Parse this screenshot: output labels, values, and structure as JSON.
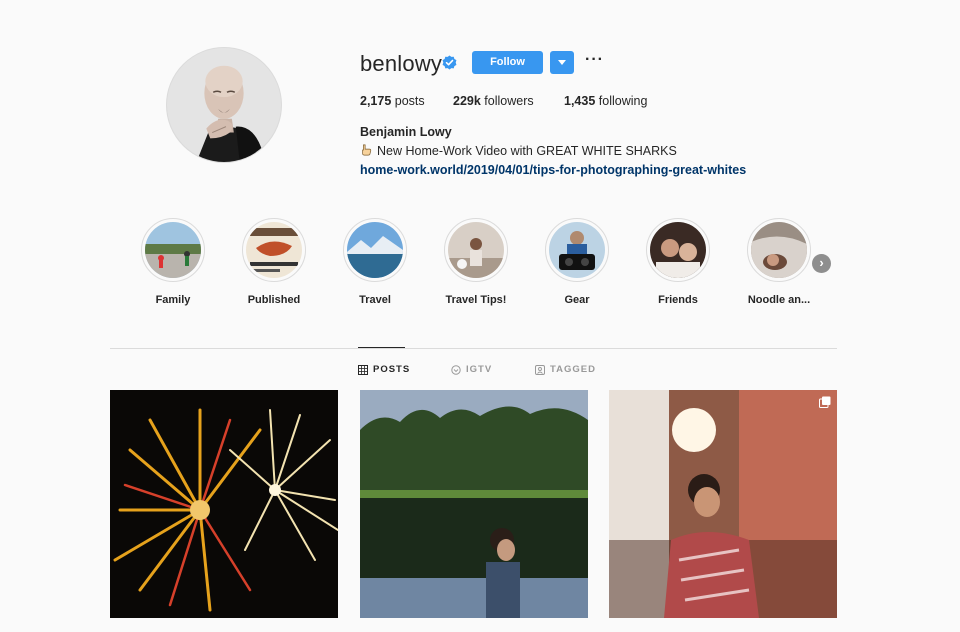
{
  "profile": {
    "username": "benlowy",
    "follow_label": "Follow",
    "more_label": "···",
    "stats": {
      "posts_count": "2,175",
      "posts_label": "posts",
      "followers_count": "229k",
      "followers_label": "followers",
      "following_count": "1,435",
      "following_label": "following"
    },
    "full_name": "Benjamin Lowy",
    "bio": "New Home-Work Video with GREAT WHITE SHARKS",
    "link": "home-work.world/2019/04/01/tips-for-photographing-great-whites"
  },
  "highlights": [
    {
      "label": "Family",
      "icon": "family-thumbnail"
    },
    {
      "label": "Published",
      "icon": "published-thumbnail"
    },
    {
      "label": "Travel",
      "icon": "travel-thumbnail"
    },
    {
      "label": "Travel Tips!",
      "icon": "travel-tips-thumbnail"
    },
    {
      "label": "Gear",
      "icon": "gear-thumbnail"
    },
    {
      "label": "Friends",
      "icon": "friends-thumbnail"
    },
    {
      "label": "Noodle an...",
      "icon": "noodle-thumbnail"
    }
  ],
  "tabs": [
    {
      "label": "POSTS",
      "icon": "grid-icon",
      "active": true
    },
    {
      "label": "IGTV",
      "icon": "igtv-icon",
      "active": false
    },
    {
      "label": "TAGGED",
      "icon": "tagged-icon",
      "active": false
    }
  ],
  "colors": {
    "accent": "#3897f0",
    "link": "#003569",
    "background": "#fafafa",
    "border": "#dbdbdb"
  }
}
